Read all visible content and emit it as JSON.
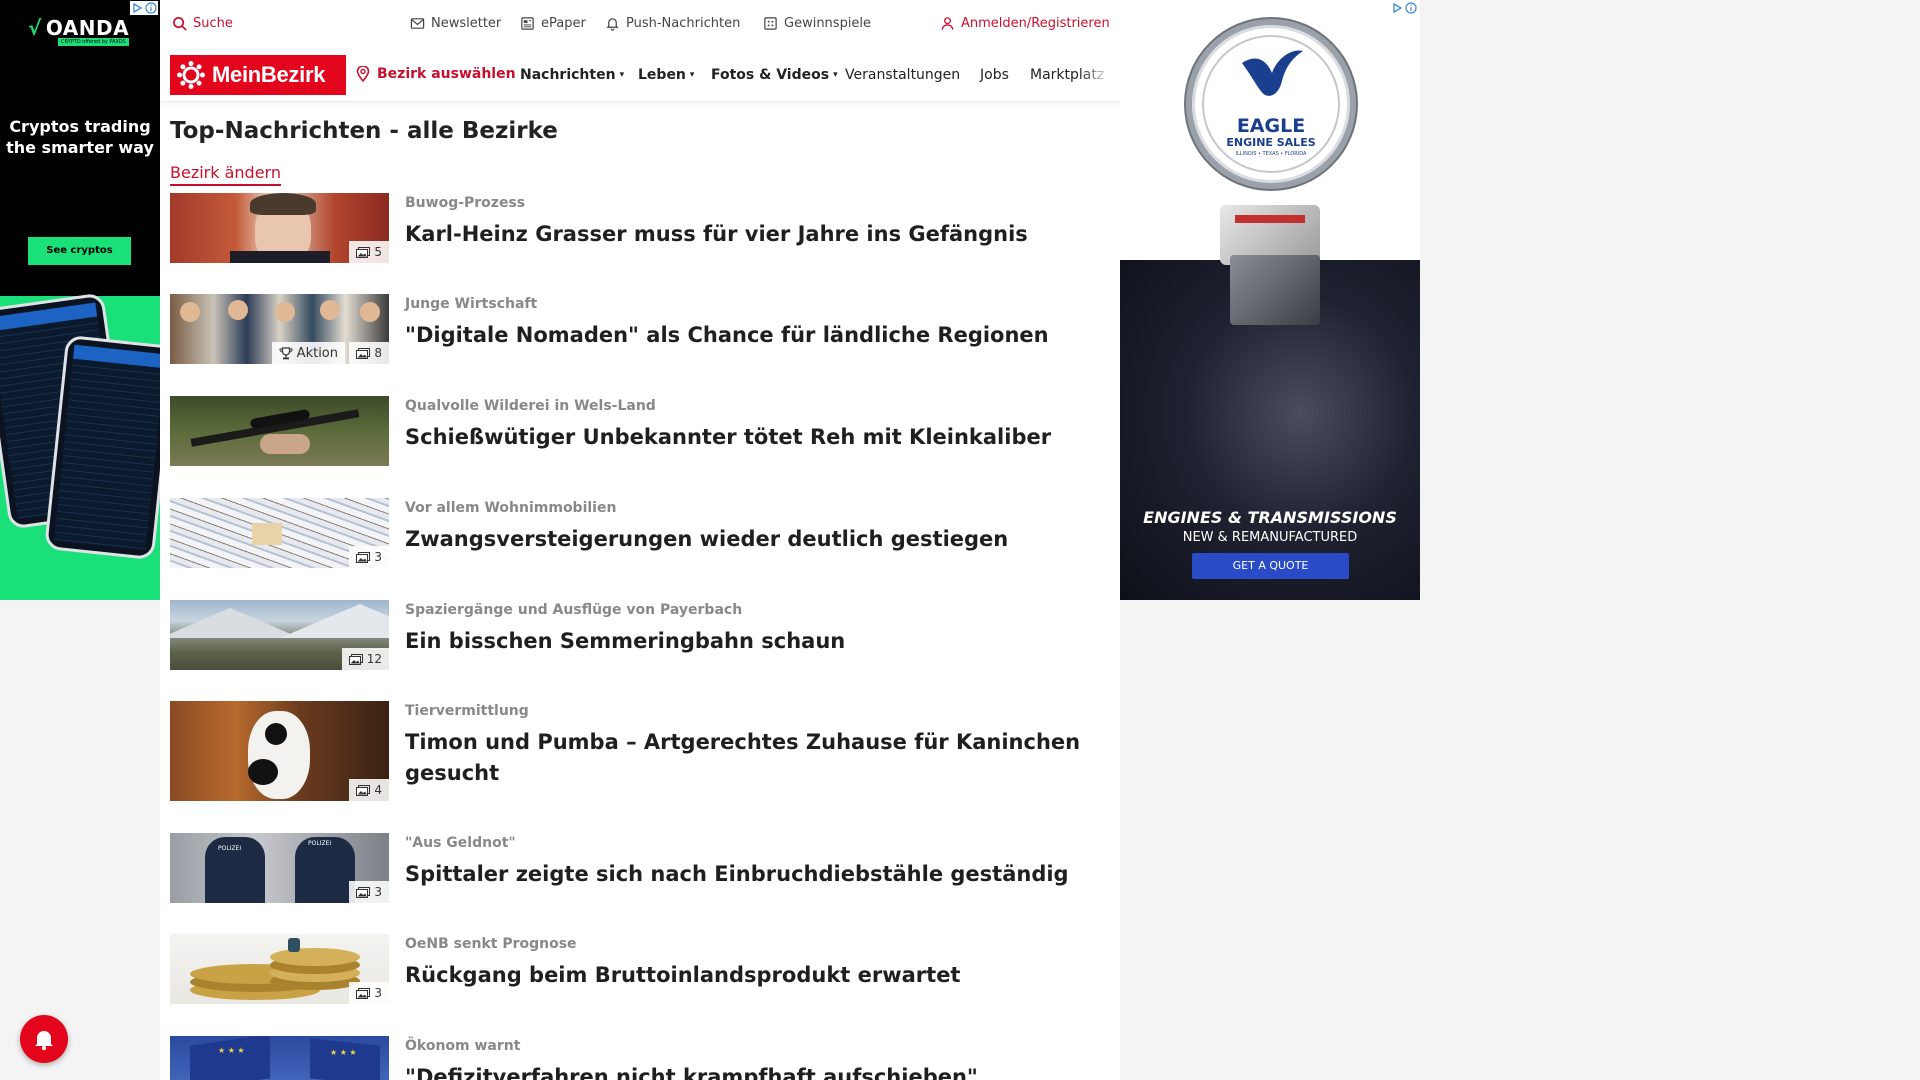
{
  "colors": {
    "brand_red": "#e3051b",
    "link_red": "#c8102e",
    "oanda_green": "#1ae07a",
    "eagle_blue": "#1b3f8f"
  },
  "left_ad": {
    "brand": "OANDA",
    "brand_sub": "CRYPTO offered by PAXOS",
    "headline": "Cryptos trading the smarter way",
    "cta": "See cryptos"
  },
  "right_ad": {
    "seal_title": "EAGLE",
    "seal_sub": "ENGINE SALES",
    "seal_mini": "ILLINOIS • TEXAS • FLORIDA",
    "line1": "ENGINES & TRANSMISSIONS",
    "line2": "NEW & REMANUFACTURED",
    "cta": "GET A QUOTE"
  },
  "topbar": {
    "search": "Suche",
    "newsletter": "Newsletter",
    "epaper": "ePaper",
    "push": "Push-Nachrichten",
    "gewinnspiele": "Gewinnspiele",
    "login": "Anmelden/Registrieren"
  },
  "nav": {
    "logo": "MeinBezirk",
    "bezirk_select": "Bezirk auswählen",
    "items": [
      "Nachrichten",
      "Leben",
      "Fotos & Videos",
      "Veranstaltungen",
      "Jobs",
      "Marktplatz"
    ]
  },
  "page_title": "Top-Nachrichten - alle Bezirke",
  "change_bezirk": "Bezirk ändern",
  "articles": [
    {
      "kicker": "Buwog-Prozess",
      "headline": "Karl-Heinz Grasser muss für vier Jahre ins Gefängnis",
      "photos": "5",
      "thumb_icon": "portrait-photo"
    },
    {
      "kicker": "Junge Wirtschaft",
      "headline": "\"Digitale Nomaden\" als Chance für ländliche Regionen",
      "photos": "8",
      "aktion": "Aktion",
      "thumb_icon": "group-photo"
    },
    {
      "kicker": "Qualvolle Wilderei in Wels-Land",
      "headline": "Schießwütiger Unbekannter tötet Reh mit Kleinkaliber",
      "thumb_icon": "rifle-photo"
    },
    {
      "kicker": "Vor allem Wohnimmobilien",
      "headline": "Zwangsversteigerungen wieder deutlich gestiegen",
      "photos": "3",
      "thumb_icon": "snowy-village-photo"
    },
    {
      "kicker": "Spaziergänge und Ausflüge von Payerbach",
      "headline": "Ein bisschen Semmeringbahn schaun",
      "photos": "12",
      "thumb_icon": "mountain-photo"
    },
    {
      "kicker": "Tiervermittlung",
      "headline": "Timon und Pumba – Artgerechtes Zuhause für Kaninchen gesucht",
      "photos": "4",
      "thumb_icon": "rabbit-photo"
    },
    {
      "kicker": "\"Aus Geldnot\"",
      "headline": "Spittaler zeigte sich nach Einbruchdiebstähle geständig",
      "photos": "3",
      "thumb_icon": "police-photo"
    },
    {
      "kicker": "OeNB senkt Prognose",
      "headline": "Rückgang beim Bruttoinlandsprodukt erwartet",
      "photos": "3",
      "thumb_icon": "coins-photo"
    },
    {
      "kicker": "Ökonom warnt",
      "headline": "\"Defizitverfahren nicht krampfhaft aufschieben\"",
      "thumb_icon": "eu-flag-photo"
    }
  ]
}
